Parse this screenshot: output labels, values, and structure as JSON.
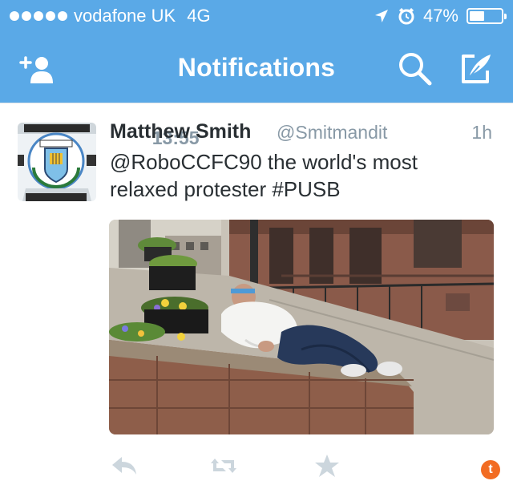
{
  "status_bar": {
    "carrier": "vodafone UK",
    "network": "4G",
    "time": "13:55",
    "battery_percent": "47%",
    "battery_level": 0.47,
    "signal_bars": 5,
    "icons": [
      "location-arrow-icon",
      "alarm-icon",
      "battery-icon"
    ]
  },
  "nav": {
    "title": "Notifications",
    "left_icon": "add-user-icon",
    "right_icons": [
      "search-icon",
      "compose-icon"
    ]
  },
  "tweet": {
    "author_name": "Matthew Smith",
    "author_handle": "@Smitmandit",
    "timestamp": "1h",
    "text_line1": "@RoboCCFC90 the world's most",
    "text_line2": "relaxed protester #PUSB",
    "avatar_icon": "coventry-city-crest-avatar",
    "actions": [
      "reply-icon",
      "retweet-icon",
      "favorite-icon"
    ],
    "badge_letter": "t"
  },
  "colors": {
    "bar": "#5aa9e7",
    "name_text": "#292f33",
    "secondary_text": "#8899a6",
    "action_icons": "#ccd6dd",
    "badge": "#f26c23"
  }
}
